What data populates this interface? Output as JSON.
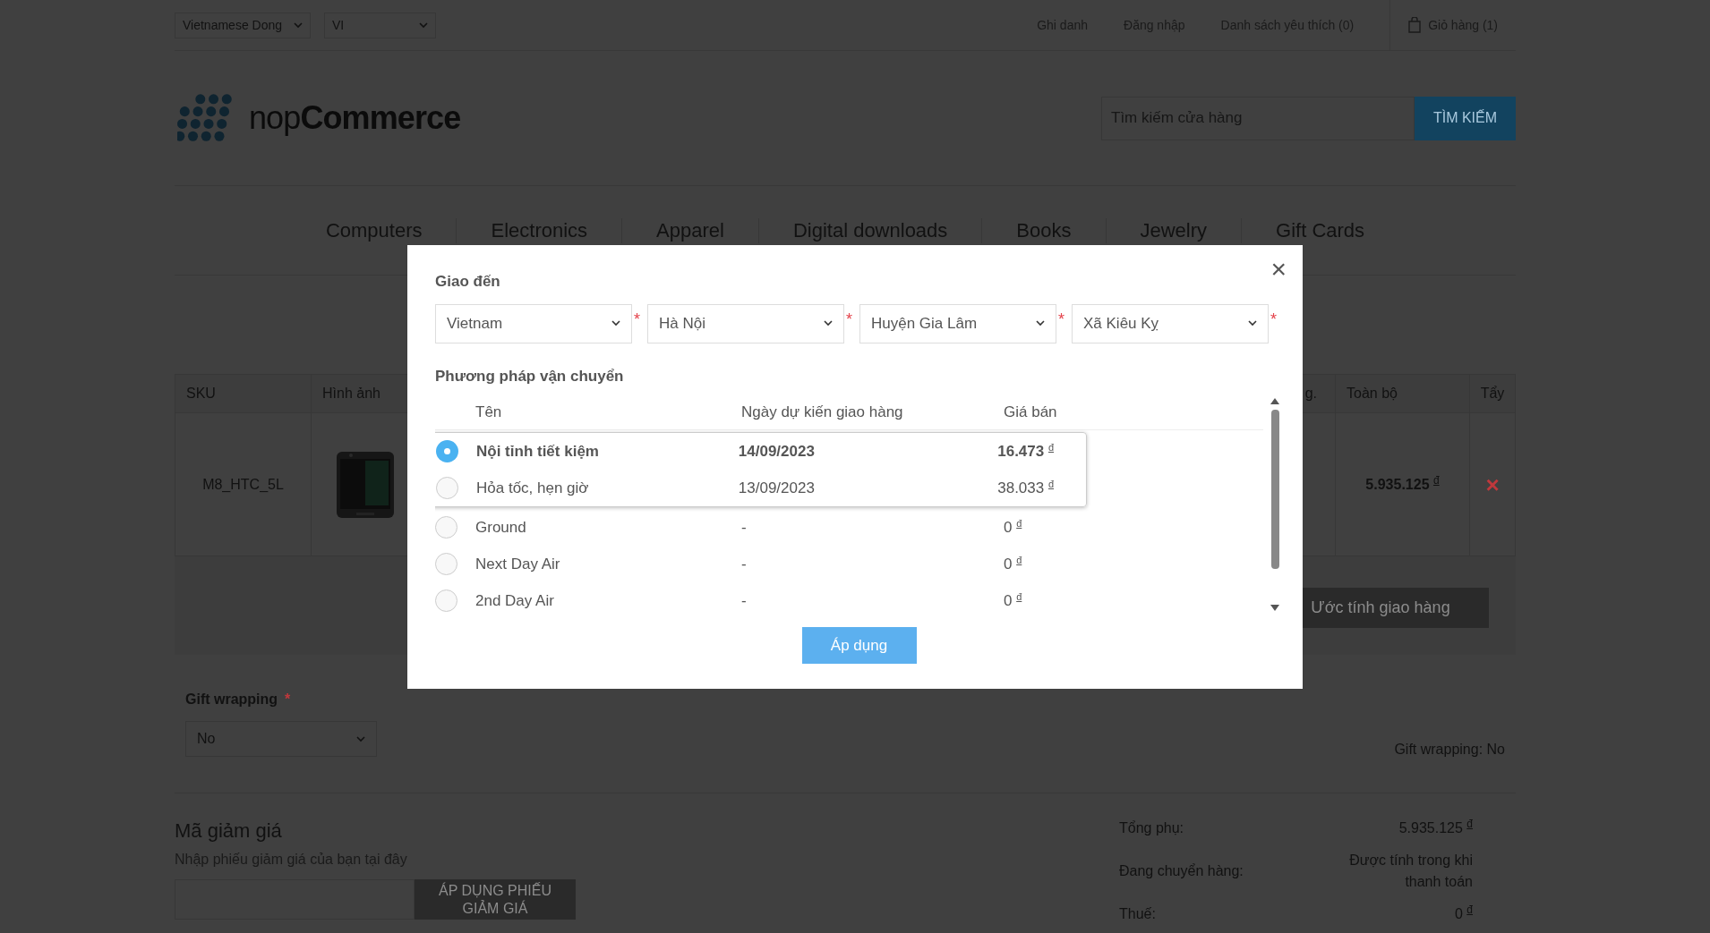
{
  "header": {
    "currency": "Vietnamese Dong",
    "language": "VI",
    "links": [
      "Ghi danh",
      "Đăng nhập",
      "Danh sách yêu thích (0)"
    ],
    "cart": "Giỏ hàng (1)"
  },
  "logo": {
    "text": "nop**Commerce**"
  },
  "search": {
    "placeholder": "Tìm kiếm cửa hàng",
    "button": "TÌM KIẾM"
  },
  "nav": [
    "Computers",
    "Electronics",
    "Apparel",
    "Digital downloads",
    "Books",
    "Jewelry",
    "Gift Cards"
  ],
  "cart_table": {
    "columns": [
      "SKU",
      "Hình ảnh",
      "g.",
      "Toàn bộ",
      "Tẩy"
    ],
    "rows": [
      {
        "sku": "M8_HTC_5L",
        "total": "5.935.125 $^{đ}$",
        "remove": "×"
      }
    ]
  },
  "estimate_button": "Ước tính giao hàng",
  "gift_wrapping": {
    "label": "Gift wrapping",
    "required": "*",
    "value": "No",
    "summary": "Gift wrapping: No"
  },
  "discount": {
    "title": "Mã giảm giá",
    "hint": "Nhập phiếu giảm giá của bạn tại đây",
    "button": "ÁP DỤNG PHIẾU GIẢM GIÁ"
  },
  "totals": [
    {
      "label": "Tổng phụ:",
      "value": "5.935.125 $^{đ}$"
    },
    {
      "label": "Đang chuyển hàng:",
      "value": "Được tính trong khi thanh toán"
    },
    {
      "label": "Thuế:",
      "value": "0 $^{đ}$"
    }
  ],
  "modal": {
    "close": "×",
    "ship_to_title": "Giao đến",
    "selects": [
      {
        "value": "Vietnam",
        "required": "*"
      },
      {
        "value": "Hà Nội",
        "required": "*"
      },
      {
        "value": "Huyện Gia Lâm",
        "required": "*"
      },
      {
        "value": "Xã Kiêu Kỵ",
        "required": "*"
      }
    ],
    "methods_title": "Phương pháp vận chuyển",
    "columns": [
      "Tên",
      "Ngày dự kiến giao hàng",
      "Giá bán"
    ],
    "methods": [
      {
        "name": "Nội tỉnh tiết kiệm",
        "date": "14/09/2023",
        "price": "16.473 $^{đ}$",
        "selected": true,
        "highlighted": true
      },
      {
        "name": "Hỏa tốc, hẹn giờ",
        "date": "13/09/2023",
        "price": "38.033 $^{đ}$",
        "selected": false,
        "highlighted": true
      },
      {
        "name": "Ground",
        "date": "-",
        "price": "0 $^{đ}$",
        "selected": false,
        "highlighted": false
      },
      {
        "name": "Next Day Air",
        "date": "-",
        "price": "0 $^{đ}$",
        "selected": false,
        "highlighted": false
      },
      {
        "name": "2nd Day Air",
        "date": "-",
        "price": "0 $^{đ}$",
        "selected": false,
        "highlighted": false
      }
    ],
    "apply": "Áp dụng"
  }
}
